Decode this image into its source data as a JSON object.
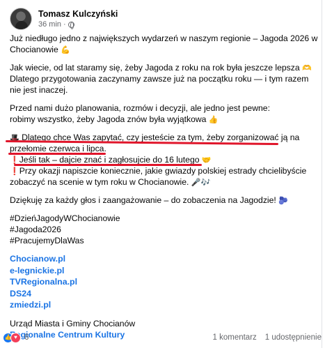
{
  "post": {
    "author": "Tomasz Kulczyński",
    "time": "36 min",
    "separator": "·"
  },
  "content": {
    "p1_l1": "Już niedługo jedno z największych wydarzeń w naszym regionie – Jagoda 2026 w",
    "p1_l2": "Chocianowie",
    "p2_l1": "Jak wiecie, od lat staramy się, żeby Jagoda z roku na rok była jeszcze lepsza",
    "p2_l2": "Dlatego przygotowania zaczynamy zawsze już na początku roku — i tym razem",
    "p2_l3": "nie jest inaczej.",
    "p3_l1": "Przed nami dużo planowania, rozmów i decyzji, ale jedno jest pewne:",
    "p3_l2": "robimy wszystko, żeby Jagoda znów była wyjątkowa",
    "p4_l1": "Dlatego chce Was zapytać, czy jesteście za tym, żeby zorganizować ją na",
    "p4_l2": "przełomie czerwca i lipca.",
    "p4_l3": "Jeśli tak – dajcie znać i zagłosujcie do 16 lutego",
    "p4_l4": "Przy okazji napiszcie koniecznie, jakie gwiazdy polskiej estrady chcielibyście",
    "p4_l5": "zobaczyć na scenie w tym roku w Chocianowie.",
    "p5": "Dziękuję za każdy głos i zaangażowanie – do zobaczenia na Jagodzie!",
    "tags": [
      "#DzieńJagodyWChocianowie",
      "#Jagoda2026",
      "#PracujemyDlaWas"
    ],
    "links": [
      "Chocianow.pl",
      "e-legnickie.pl",
      "TVRegionalna.pl",
      "DS24",
      "zmiedzi.pl"
    ],
    "footer_l1": "Urząd Miasta i Gminy Chocianów",
    "footer_l2": "Regionalne Centrum Kultury"
  },
  "stats": {
    "reaction_count": "6",
    "comments": "1 komentarz",
    "shares": "1 udostępnienie"
  },
  "colors": {
    "link": "#1b74e4",
    "underline": "#e0162b",
    "meta": "#65676b"
  }
}
